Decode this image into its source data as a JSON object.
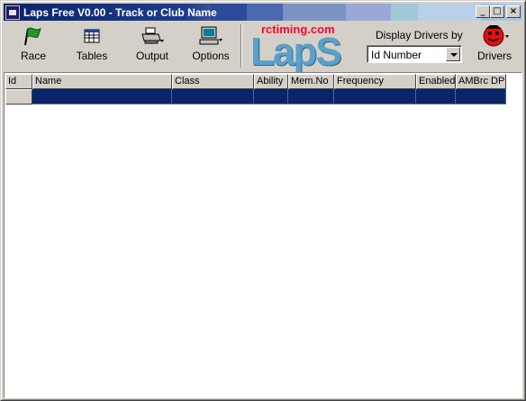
{
  "window": {
    "title": "Laps Free V0.00 - Track or Club Name",
    "controls": {
      "minimize": "_",
      "maximize": "□",
      "close": "×"
    }
  },
  "toolbar": {
    "race": {
      "label": "Race",
      "icon": "green-flag-icon"
    },
    "tables": {
      "label": "Tables",
      "icon": "table-grid-icon"
    },
    "output": {
      "label": "Output",
      "icon": "printer-icon"
    },
    "options": {
      "label": "Options",
      "icon": "computer-icon"
    },
    "drivers": {
      "label": "Drivers",
      "icon": "red-ball-driver-icon"
    }
  },
  "logo": {
    "site": "rctiming.com",
    "brand": "LapS"
  },
  "display_drivers": {
    "label": "Display Drivers by",
    "selected": "Id Number"
  },
  "grid": {
    "columns": [
      "Id",
      "Name",
      "Class",
      "Ability",
      "Mem.No",
      "Frequency",
      "Enabled",
      "AMBrc DP"
    ]
  },
  "colors": {
    "titlebar_start": "#0a246a",
    "selection": "#0a246a",
    "logo_blue": "#5aa0c8",
    "logo_red": "#ff0033"
  }
}
